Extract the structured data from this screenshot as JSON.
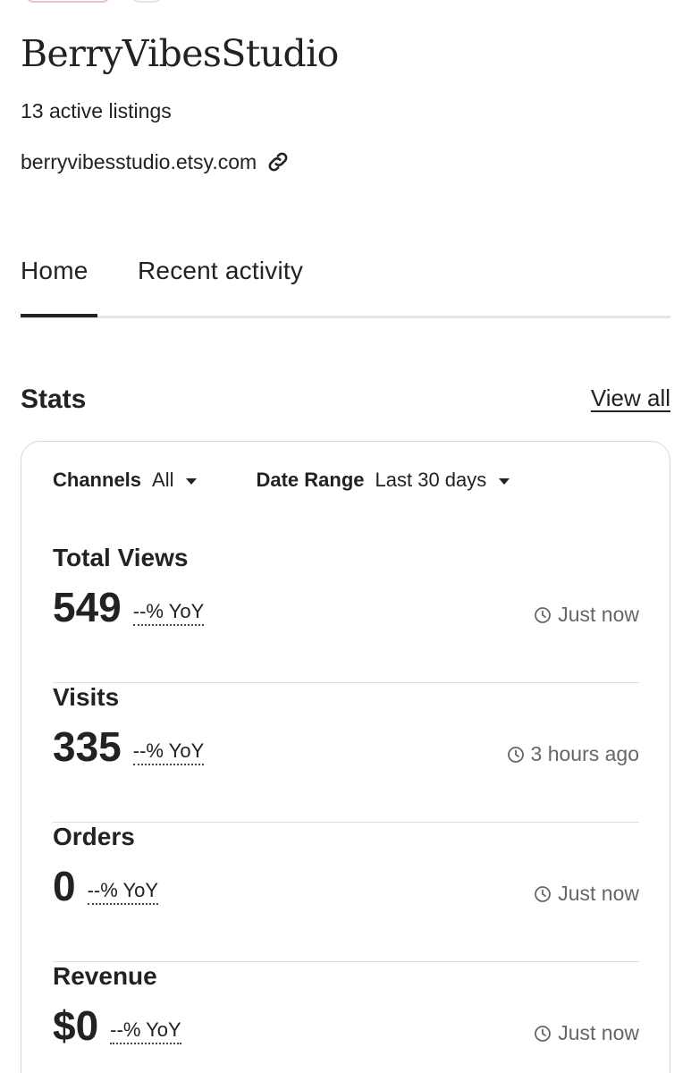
{
  "shop": {
    "name": "BerryVibesStudio",
    "listings": "13 active listings",
    "url": "berryvibesstudio.etsy.com",
    "url_icon": "link-icon"
  },
  "tabs": [
    {
      "label": "Home",
      "active": true
    },
    {
      "label": "Recent activity",
      "active": false
    }
  ],
  "stats": {
    "title": "Stats",
    "view_all": "View all",
    "filters": {
      "channels_label": "Channels",
      "channels_value": "All",
      "date_label": "Date Range",
      "date_value": "Last 30 days"
    },
    "rows": [
      {
        "label": "Total Views",
        "value": "549",
        "yoy": "--% YoY",
        "updated": "Just now"
      },
      {
        "label": "Visits",
        "value": "335",
        "yoy": "--% YoY",
        "updated": "3 hours ago"
      },
      {
        "label": "Orders",
        "value": "0",
        "yoy": "--% YoY",
        "updated": "Just now"
      },
      {
        "label": "Revenue",
        "value": "$0",
        "yoy": "--% YoY",
        "updated": "Just now"
      }
    ]
  },
  "colors": {
    "text": "#222222",
    "muted": "#666666",
    "divider": "#dedede"
  }
}
